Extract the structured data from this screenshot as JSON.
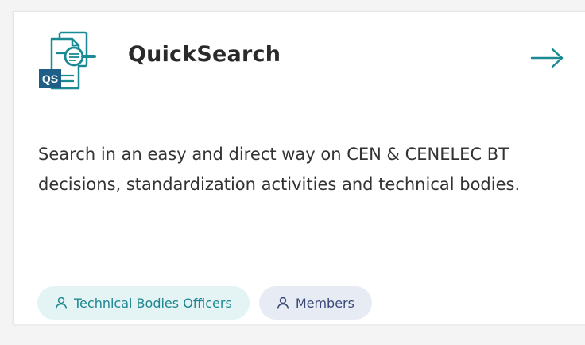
{
  "card": {
    "title": "QuickSearch",
    "logo_text": "QS",
    "description": "Search in an easy and direct way on CEN & CENELEC BT decisions, standardization activities and technical bodies.",
    "tags": [
      {
        "label": "Technical Bodies Officers",
        "icon": "user-icon"
      },
      {
        "label": "Members",
        "icon": "user-icon"
      }
    ]
  },
  "colors": {
    "accent": "#1b8a93",
    "logo_badge": "#1d5f86",
    "tag_teal_bg": "#e4f3f4",
    "tag_blue_bg": "#e7ebf4"
  }
}
